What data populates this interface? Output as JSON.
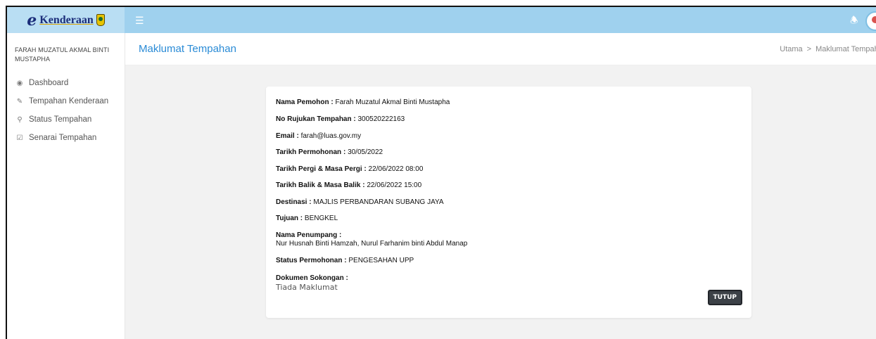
{
  "brand": {
    "logo_text": "Kenderaan"
  },
  "user": {
    "name": "FARAH MUZATUL AKMAL BINTI MUSTAPHA"
  },
  "sidebar": {
    "items": [
      {
        "label": "Dashboard",
        "icon": "dashboard-icon"
      },
      {
        "label": "Tempahan Kenderaan",
        "icon": "edit-icon"
      },
      {
        "label": "Status Tempahan",
        "icon": "search-icon"
      },
      {
        "label": "Senarai Tempahan",
        "icon": "checkbox-icon"
      }
    ]
  },
  "header": {
    "title": "Maklumat Tempahan",
    "breadcrumb": [
      "Utama",
      "Maklumat Tempahan"
    ]
  },
  "details": {
    "nama_pemohon": {
      "label": "Nama Pemohon :",
      "value": "Farah Muzatul Akmal Binti Mustapha"
    },
    "no_rujukan": {
      "label": "No Rujukan Tempahan :",
      "value": "300520222163"
    },
    "email": {
      "label": "Email :",
      "value": "farah@luas.gov.my"
    },
    "tarikh_permohonan": {
      "label": "Tarikh Permohonan :",
      "value": "30/05/2022"
    },
    "tarikh_pergi": {
      "label": "Tarikh Pergi & Masa Pergi :",
      "value": "22/06/2022 08:00"
    },
    "tarikh_balik": {
      "label": "Tarikh Balik & Masa Balik :",
      "value": "22/06/2022 15:00"
    },
    "destinasi": {
      "label": "Destinasi :",
      "value": "MAJLIS PERBANDARAN SUBANG JAYA"
    },
    "tujuan": {
      "label": "Tujuan :",
      "value": "BENGKEL"
    },
    "penumpang": {
      "label": "Nama Penumpang :",
      "value": "Nur Husnah Binti Hamzah, Nurul Farhanim binti Abdul Manap"
    },
    "status": {
      "label": "Status Permohonan :",
      "value": "PENGESAHAN UPP"
    },
    "dokumen": {
      "label": "Dokumen Sokongan :",
      "value": "Tiada Maklumat"
    }
  },
  "buttons": {
    "close_label": "TUTUP"
  },
  "colors": {
    "topbar": "#9fd1ee",
    "title": "#2a8bd6",
    "button": "#3c4147"
  }
}
